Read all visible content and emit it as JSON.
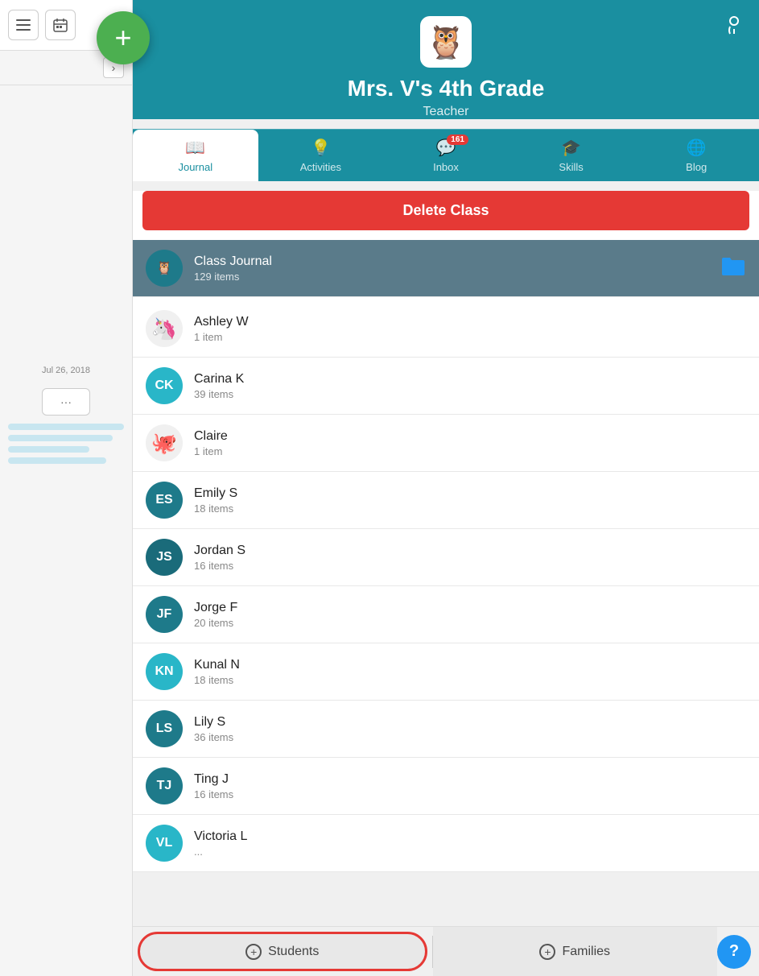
{
  "sidebar": {
    "date": "Jul 26, 2018",
    "more_label": "···"
  },
  "fab": {
    "icon": "+"
  },
  "header": {
    "owl_emoji": "🦉",
    "title": "Mrs. V's 4th Grade",
    "subtitle": "Teacher",
    "settings_icon": "settings"
  },
  "tabs": [
    {
      "id": "journal",
      "label": "Journal",
      "icon": "📖",
      "active": true,
      "badge": null
    },
    {
      "id": "activities",
      "label": "Activities",
      "icon": "💡",
      "active": false,
      "badge": null
    },
    {
      "id": "inbox",
      "label": "Inbox",
      "icon": "💬",
      "active": false,
      "badge": "161"
    },
    {
      "id": "skills",
      "label": "Skills",
      "icon": "🎓",
      "active": false,
      "badge": null
    },
    {
      "id": "blog",
      "label": "Blog",
      "icon": "🌐",
      "active": false,
      "badge": null
    }
  ],
  "delete_button": "Delete Class",
  "class_journal": {
    "name": "Class Journal",
    "items": "129 items",
    "selected": true
  },
  "students": [
    {
      "id": "ashley-w",
      "name": "Ashley W",
      "items": "1 item",
      "avatar_type": "emoji",
      "avatar_emoji": "🦄",
      "avatar_color": "#f5f5f5",
      "initials": ""
    },
    {
      "id": "carina-k",
      "name": "Carina K",
      "items": "39 items",
      "avatar_type": "initials",
      "initials": "CK",
      "avatar_color": "#29b6c8"
    },
    {
      "id": "claire",
      "name": "Claire",
      "items": "1 item",
      "avatar_type": "emoji",
      "avatar_emoji": "🐙",
      "avatar_color": "#f5f5f5",
      "initials": ""
    },
    {
      "id": "emily-s",
      "name": "Emily S",
      "items": "18 items",
      "avatar_type": "initials",
      "initials": "ES",
      "avatar_color": "#1e7a8a"
    },
    {
      "id": "jordan-s",
      "name": "Jordan S",
      "items": "16 items",
      "avatar_type": "initials",
      "initials": "JS",
      "avatar_color": "#1a6b7a"
    },
    {
      "id": "jorge-f",
      "name": "Jorge F",
      "items": "20 items",
      "avatar_type": "initials",
      "initials": "JF",
      "avatar_color": "#1e7a8a"
    },
    {
      "id": "kunal-n",
      "name": "Kunal N",
      "items": "18 items",
      "avatar_type": "initials",
      "initials": "KN",
      "avatar_color": "#29b6c8"
    },
    {
      "id": "lily-s",
      "name": "Lily S",
      "items": "36 items",
      "avatar_type": "initials",
      "initials": "LS",
      "avatar_color": "#1e7a8a"
    },
    {
      "id": "ting-j",
      "name": "Ting J",
      "items": "16 items",
      "avatar_type": "initials",
      "initials": "TJ",
      "avatar_color": "#1e7a8a"
    },
    {
      "id": "victoria-l",
      "name": "Victoria L",
      "items": "...",
      "avatar_type": "initials",
      "initials": "VL",
      "avatar_color": "#29b6c8"
    }
  ],
  "bottom": {
    "students_label": "Students",
    "families_label": "Families",
    "plus_icon": "+",
    "help_label": "?"
  }
}
